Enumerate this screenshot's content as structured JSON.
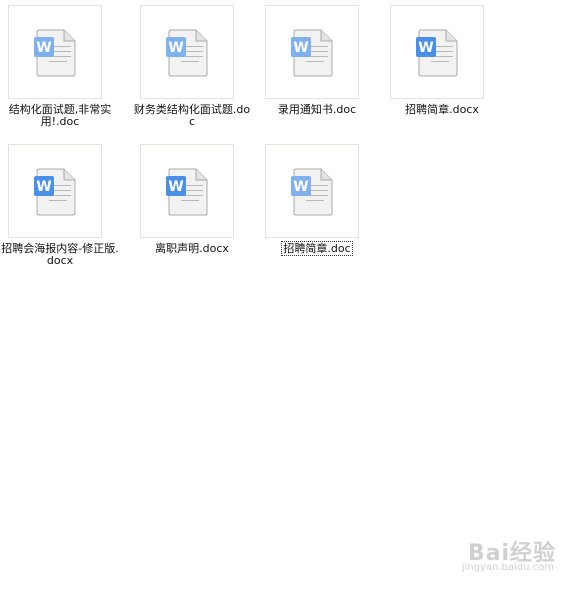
{
  "files": [
    {
      "name": "结构化面试题,非常实用!.doc",
      "icon": "wps-word-doc-icon",
      "selected": false
    },
    {
      "name": "财务类结构化面试题.doc",
      "icon": "wps-word-doc-icon",
      "selected": false
    },
    {
      "name": "录用通知书.doc",
      "icon": "wps-word-doc-icon",
      "selected": false
    },
    {
      "name": "招聘简章.docx",
      "icon": "wps-word-docx-icon",
      "selected": false
    },
    {
      "name": "招聘会海报内容-修正版.docx",
      "icon": "wps-word-docx-icon",
      "selected": false
    },
    {
      "name": "离职声明.docx",
      "icon": "wps-word-docx-icon",
      "selected": false
    },
    {
      "name": "招聘简章.doc",
      "icon": "wps-word-doc-icon",
      "selected": true
    }
  ],
  "watermark": {
    "logo": "Bai经验",
    "url": "jingyan.baidu.com"
  },
  "colors": {
    "icon_blue": "#4a8fe8",
    "icon_blue_light": "#7fb0f0",
    "thumb_border": "#e6e3d8"
  }
}
